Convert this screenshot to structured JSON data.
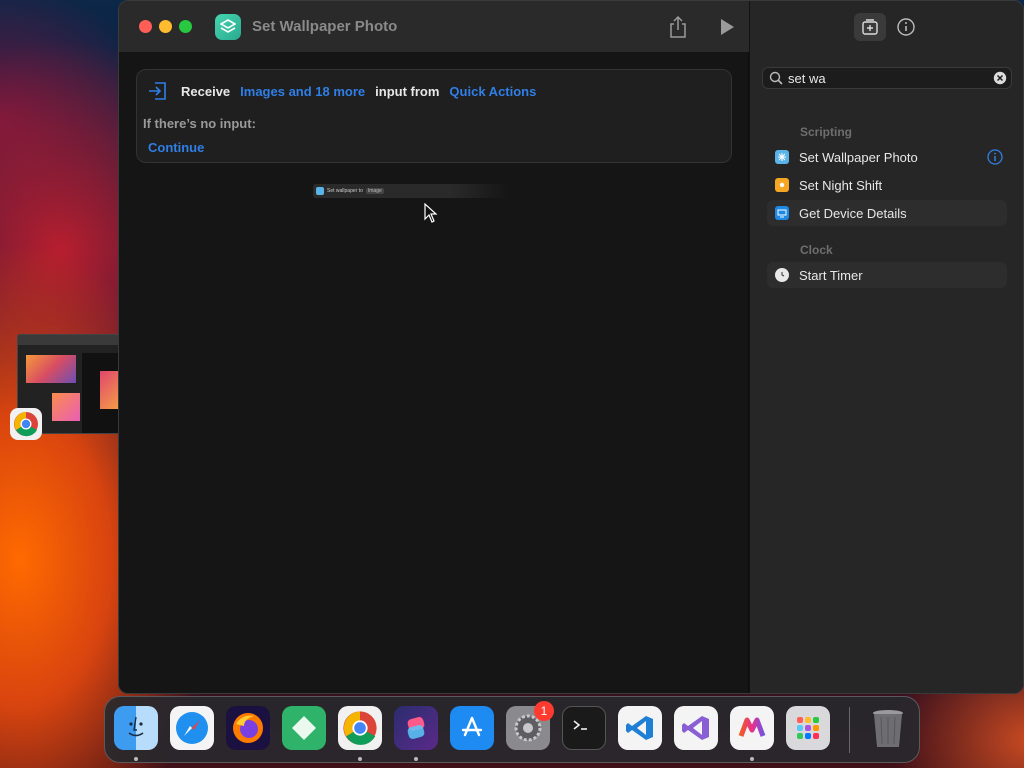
{
  "window": {
    "title": "Set Wallpaper Photo"
  },
  "receive": {
    "receive_label": "Receive",
    "input_types": "Images and 18 more",
    "input_from_label": "input from",
    "source": "Quick Actions",
    "no_input_label": "If there’s no input:",
    "no_input_action": "Continue"
  },
  "drag_ghost": {
    "label": "Set wallpaper to",
    "value": "Image"
  },
  "sidebar": {
    "search": {
      "value": "set wa"
    },
    "sections": [
      {
        "title": "Scripting",
        "items": [
          {
            "label": "Set Wallpaper Photo",
            "icon": "wallpaper-icon"
          },
          {
            "label": "Set Night Shift",
            "icon": "night-shift-icon"
          },
          {
            "label": "Get Device Details",
            "icon": "device-icon"
          }
        ]
      },
      {
        "title": "Clock",
        "items": [
          {
            "label": "Start Timer",
            "icon": "timer-icon"
          }
        ]
      }
    ]
  },
  "dock": {
    "apps": [
      "Finder",
      "Safari",
      "Firefox",
      "Tailscale",
      "Chrome",
      "Shortcuts",
      "App Store",
      "System Settings",
      "Terminal",
      "Visual Studio Code",
      "Visual Studio",
      "Microsoft Office",
      "Launchpad",
      "Trash"
    ],
    "settings_badge": "1"
  },
  "colors": {
    "accent_blue": "#2f7fe6",
    "shortcuts_teal": "#2aa98f"
  }
}
